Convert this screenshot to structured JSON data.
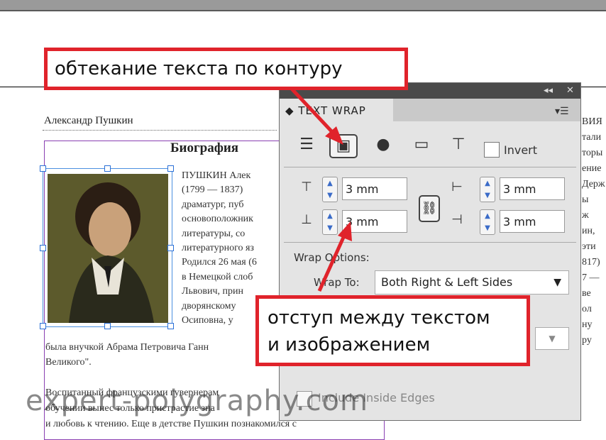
{
  "document": {
    "author": "Александр Пушкин",
    "heading": "Биография",
    "lines": [
      "ПУШКИН   Алек",
      "(1799  —  1837)",
      "драматург,    пуб",
      "основоположник",
      "литературы,     со",
      "литературного яз",
      "Родился 26 мая (6",
      "в Немецкой слоб",
      "Львович,   прин",
      "дворянскому",
      "Осиповна,   у"
    ],
    "lines_full": [
      "была внучкой Абрама Петровича Ганн",
      "Великого\"."
    ],
    "lines_bottom": [
      "Воспитанный   французскими   гувернерам",
      "обучении   вынес   только   пристрастие   зна",
      "и любовь к чтению. Еще в детстве Пушкин познакомился с"
    ],
    "right_column": [
      "ВИЯ",
      "тали",
      "торы",
      "ение",
      "Держ",
      "ы",
      "ж ",
      "ин, ",
      "эти",
      "817)",
      "7 —",
      "ве",
      "ол",
      "ну",
      "ру"
    ]
  },
  "panel": {
    "title": "TEXT WRAP",
    "wrap_buttons": [
      "no-wrap",
      "wrap-around-bounding-box",
      "wrap-around-object-shape",
      "jump-object",
      "jump-to-next-column"
    ],
    "selected_wrap": "wrap-around-bounding-box",
    "invert_label": "Invert",
    "offsets": {
      "top": "3 mm",
      "bottom": "3 mm",
      "left": "3 mm",
      "right": "3 mm"
    },
    "wrap_options_label": "Wrap Options:",
    "wrap_to_label": "Wrap To:",
    "wrap_to_value": "Both Right & Left Sides",
    "include_inside_edges_label": "Include Inside Edges",
    "collapse_glyph": "◂◂",
    "close_glyph": "✕"
  },
  "callouts": {
    "top": "обтекание текста по контуру",
    "bottom_line1": "отступ между текстом",
    "bottom_line2": "и изображением"
  },
  "watermark": "expert-polygraphy.com",
  "colors": {
    "callout_border": "#e0232b",
    "frame_purple": "#8a3fb2",
    "selection_blue": "#4a8fe0"
  }
}
